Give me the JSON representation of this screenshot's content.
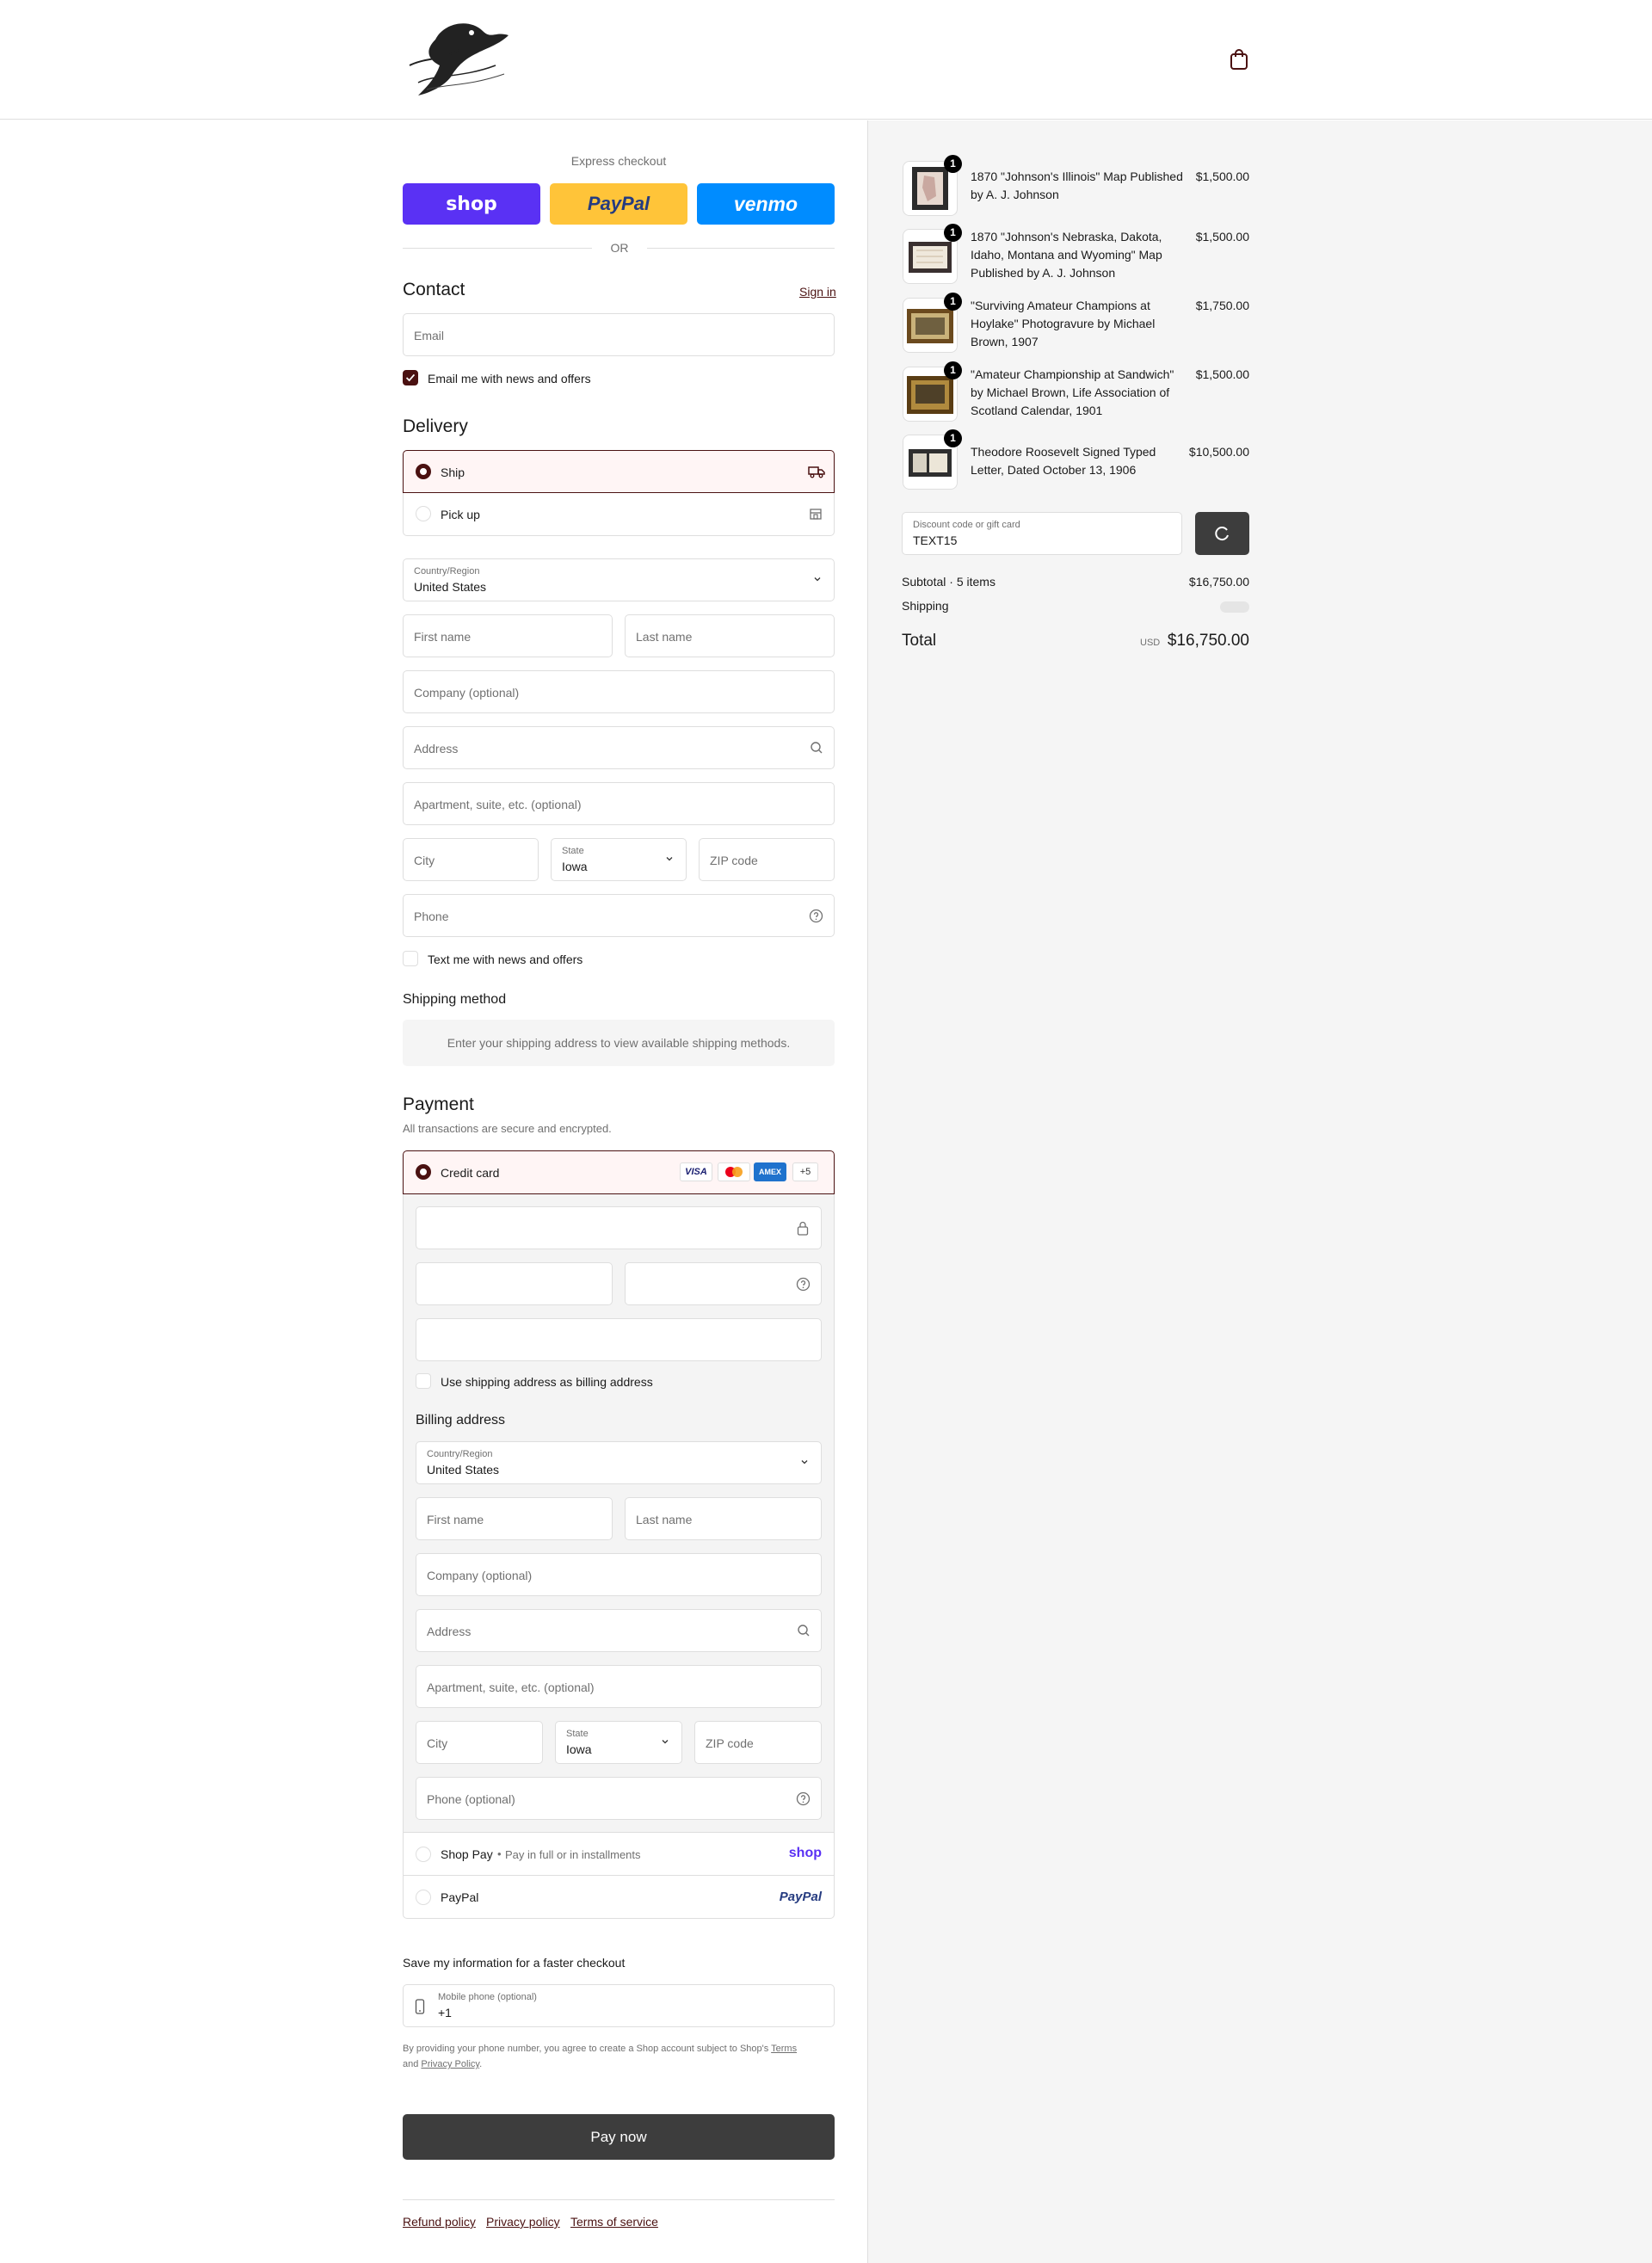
{
  "header": {
    "logo_alt": "eagle logo",
    "cart_icon": "shopping-bag-icon"
  },
  "express": {
    "title": "Express checkout",
    "shop_label": "shop",
    "paypal_label": "PayPal",
    "venmo_label": "venmo",
    "or_label": "OR"
  },
  "contact": {
    "title": "Contact",
    "sign_in": "Sign in",
    "email_placeholder": "Email",
    "newsletter_label": "Email me with news and offers",
    "newsletter_checked": true
  },
  "delivery": {
    "title": "Delivery",
    "ship_label": "Ship",
    "pickup_label": "Pick up",
    "country_label": "Country/Region",
    "country_value": "United States",
    "first_name": "First name",
    "last_name": "Last name",
    "company": "Company (optional)",
    "address": "Address",
    "apartment": "Apartment, suite, etc. (optional)",
    "city": "City",
    "state_label": "State",
    "state_value": "Iowa",
    "zip": "ZIP code",
    "phone": "Phone",
    "sms_label": "Text me with news and offers"
  },
  "shipping_method": {
    "title": "Shipping method",
    "notice": "Enter your shipping address to view available shipping methods."
  },
  "payment": {
    "title": "Payment",
    "subtitle": "All transactions are secure and encrypted.",
    "credit_card_label": "Credit card",
    "cards": [
      "VISA",
      "MC",
      "AMEX",
      "+5"
    ],
    "use_shipping_label": "Use shipping address as billing address",
    "billing_title": "Billing address",
    "country_label": "Country/Region",
    "country_value": "United States",
    "first_name": "First name",
    "last_name": "Last name",
    "company": "Company (optional)",
    "address": "Address",
    "apartment": "Apartment, suite, etc. (optional)",
    "city": "City",
    "state_label": "State",
    "state_value": "Iowa",
    "zip": "ZIP code",
    "phone": "Phone (optional)",
    "shoppay_label": "Shop Pay",
    "shoppay_sub": "Pay in full or in installments",
    "shoppay_logo": "shop",
    "paypal_label": "PayPal",
    "paypal_logo": "PayPal"
  },
  "save_info": {
    "title": "Save my information for a faster checkout",
    "mobile_label": "Mobile phone (optional)",
    "mobile_value": "+1",
    "legal_prefix": "By providing your phone number, you agree to create a Shop account subject to Shop's",
    "terms": "Terms",
    "and": "and",
    "privacy": "Privacy Policy",
    "period": "."
  },
  "pay_now": "Pay now",
  "footer": {
    "refund": "Refund policy",
    "privacy": "Privacy policy",
    "terms": "Terms of service"
  },
  "summary": {
    "items": [
      {
        "name": "1870 \"Johnson's Illinois\" Map Published by A. J. Johnson",
        "price": "$1,500.00",
        "qty": "1"
      },
      {
        "name": "1870 \"Johnson's Nebraska, Dakota, Idaho, Montana and Wyoming\" Map Published by A. J. Johnson",
        "price": "$1,500.00",
        "qty": "1"
      },
      {
        "name": "\"Surviving Amateur Champions at Hoylake\" Photogravure by Michael Brown, 1907",
        "price": "$1,750.00",
        "qty": "1"
      },
      {
        "name": "\"Amateur Championship at Sandwich\" by Michael Brown, Life Association of Scotland Calendar, 1901",
        "price": "$1,500.00",
        "qty": "1"
      },
      {
        "name": "Theodore Roosevelt Signed Typed Letter, Dated October 13, 1906",
        "price": "$10,500.00",
        "qty": "1"
      }
    ],
    "discount_label": "Discount code or gift card",
    "discount_value": "TEXT15",
    "subtotal_label": "Subtotal · 5 items",
    "subtotal_value": "$16,750.00",
    "shipping_label": "Shipping",
    "total_label": "Total",
    "currency": "USD",
    "total_value": "$16,750.00"
  },
  "colors": {
    "accent": "#4a1111",
    "accent_bg": "#fff5f5",
    "shop_purple": "#5a31f4",
    "paypal_yellow": "#ffc439",
    "venmo_blue": "#008cff",
    "pay_button": "#3d3d3d"
  }
}
